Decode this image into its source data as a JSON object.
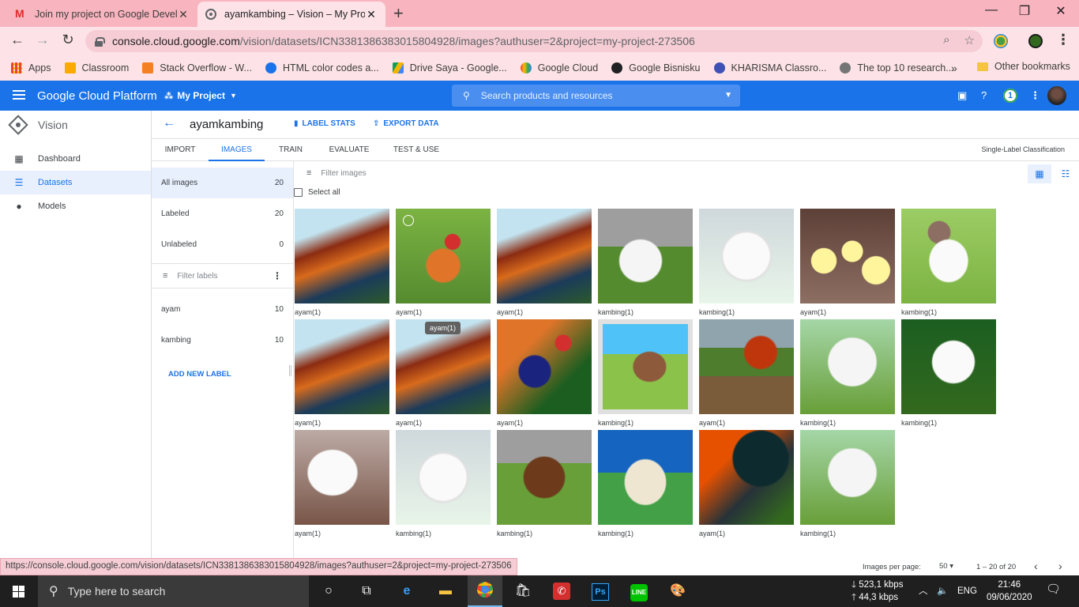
{
  "browser": {
    "tabs": [
      {
        "title": "Join my project on Google Devel",
        "icon": "gmail-icon"
      },
      {
        "title": "ayamkambing – Vision – My Proj",
        "icon": "cloud-icon"
      }
    ],
    "url_host": "console.cloud.google.com",
    "url_path": "/vision/datasets/ICN3381386383015804928/images?authuser=2&project=my-project-273506",
    "bookmarks": [
      {
        "label": "Apps",
        "color": "#ea4335"
      },
      {
        "label": "Classroom",
        "color": "#f9ab00"
      },
      {
        "label": "Stack Overflow - W...",
        "color": "#f48024"
      },
      {
        "label": "HTML color codes a...",
        "color": "#1a73e8"
      },
      {
        "label": "Drive Saya - Google...",
        "color": "#0f9d58"
      },
      {
        "label": "Google Cloud",
        "color": "#4285f4"
      },
      {
        "label": "Google Bisnisku",
        "color": "#202124"
      },
      {
        "label": "KHARISMA Classro...",
        "color": "#3f51b5"
      },
      {
        "label": "The top 10 research...",
        "color": "#757575"
      }
    ],
    "bookmarks_more": "»",
    "other_bookmarks": "Other bookmarks",
    "status_url": "https://console.cloud.google.com/vision/datasets/ICN3381386383015804928/images?authuser=2&project=my-project-273506"
  },
  "gcp": {
    "title": "Google Cloud Platform",
    "project": "My Project",
    "search_placeholder": "Search products and resources",
    "notification_count": "1"
  },
  "sidebar": {
    "product": "Vision",
    "items": [
      {
        "label": "Dashboard",
        "icon": "dashboard-icon"
      },
      {
        "label": "Datasets",
        "icon": "list-icon",
        "active": true
      },
      {
        "label": "Models",
        "icon": "bulb-icon"
      }
    ]
  },
  "dataset": {
    "name": "ayamkambing",
    "label_stats": "LABEL STATS",
    "export_data": "EXPORT DATA",
    "tabs": [
      "IMPORT",
      "IMAGES",
      "TRAIN",
      "EVALUATE",
      "TEST & USE"
    ],
    "active_tab": "IMAGES",
    "classification": "Single-Label Classification"
  },
  "label_panel": {
    "rows": [
      {
        "label": "All images",
        "count": "20"
      },
      {
        "label": "Labeled",
        "count": "20"
      },
      {
        "label": "Unlabeled",
        "count": "0"
      }
    ],
    "filter_placeholder": "Filter labels",
    "labels": [
      {
        "label": "ayam",
        "count": "10"
      },
      {
        "label": "kambing",
        "count": "10"
      }
    ],
    "add_new_label": "ADD NEW LABEL"
  },
  "images": {
    "filter_placeholder": "Filter images",
    "select_all": "Select all",
    "tooltip": "ayam(1)",
    "items": [
      {
        "caption": "ayam(1)",
        "kind": "rooster"
      },
      {
        "caption": "ayam(1)",
        "kind": "rooster-grass"
      },
      {
        "caption": "ayam(1)",
        "kind": "rooster"
      },
      {
        "caption": "kambing(1)",
        "kind": "goat-white"
      },
      {
        "caption": "kambing(1)",
        "kind": "goat-face"
      },
      {
        "caption": "ayam(1)",
        "kind": "chicks"
      },
      {
        "caption": "kambing(1)",
        "kind": "goat-brown-white"
      },
      {
        "caption": "ayam(1)",
        "kind": "rooster"
      },
      {
        "caption": "ayam(1)",
        "kind": "rooster"
      },
      {
        "caption": "ayam(1)",
        "kind": "rooster-blue"
      },
      {
        "caption": "kambing(1)",
        "kind": "goat-framed"
      },
      {
        "caption": "ayam(1)",
        "kind": "rooster-field"
      },
      {
        "caption": "kambing(1)",
        "kind": "goat-white-grass"
      },
      {
        "caption": "kambing(1)",
        "kind": "goat-dark-bg"
      },
      {
        "caption": "ayam(1)",
        "kind": "hen-white"
      },
      {
        "caption": "kambing(1)",
        "kind": "goat-face"
      },
      {
        "caption": "kambing(1)",
        "kind": "goat-brown"
      },
      {
        "caption": "kambing(1)",
        "kind": "goat-sky"
      },
      {
        "caption": "ayam(1)",
        "kind": "rooster-black"
      },
      {
        "caption": "kambing(1)",
        "kind": "goat-white-grass"
      }
    ]
  },
  "pager": {
    "per_page_label": "Images per page:",
    "per_page_value": "50",
    "range": "1 – 20 of 20"
  },
  "taskbar": {
    "search_placeholder": "Type here to search",
    "net_down": "523,1 kbps",
    "net_up": "44,3 kbps",
    "lang": "ENG",
    "time": "21:46",
    "date": "09/06/2020"
  }
}
